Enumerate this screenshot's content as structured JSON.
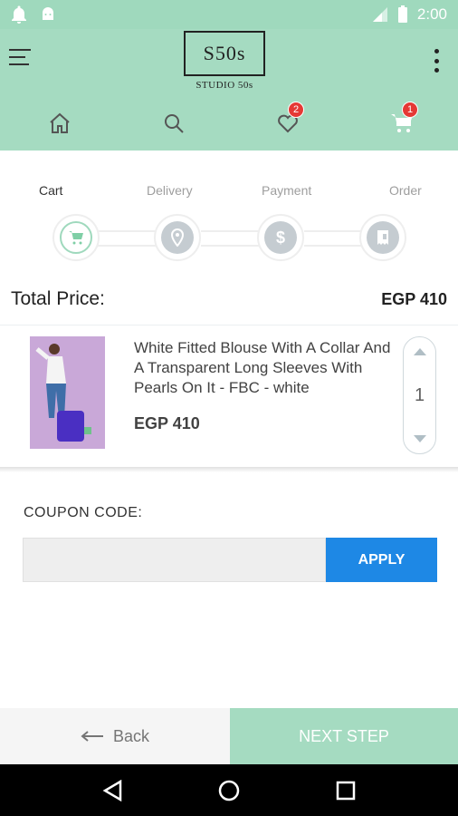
{
  "status_bar": {
    "time": "2:00"
  },
  "header": {
    "logo_main": "S50s",
    "logo_sub": "STUDIO 50s",
    "wishlist_count": "2",
    "cart_count": "1"
  },
  "steps": [
    {
      "label": "Cart",
      "icon": "cart-icon",
      "active": true
    },
    {
      "label": "Delivery",
      "icon": "location-pin-icon",
      "active": false
    },
    {
      "label": "Payment",
      "icon": "dollar-icon",
      "active": false
    },
    {
      "label": "Order",
      "icon": "receipt-icon",
      "active": false
    }
  ],
  "total": {
    "label": "Total Price:",
    "value": "EGP 410"
  },
  "cart_item": {
    "title": "White Fitted Blouse With A Collar And A Transparent Long Sleeves With Pearls On It - FBC - white",
    "price": "EGP 410",
    "quantity": "1"
  },
  "coupon": {
    "label": "COUPON CODE:",
    "value": "",
    "apply_label": "APPLY"
  },
  "footer": {
    "back_label": "Back",
    "next_label": "NEXT STEP"
  },
  "colors": {
    "accent": "#a5dbc1",
    "apply": "#1e88e5",
    "badge": "#e53935"
  }
}
